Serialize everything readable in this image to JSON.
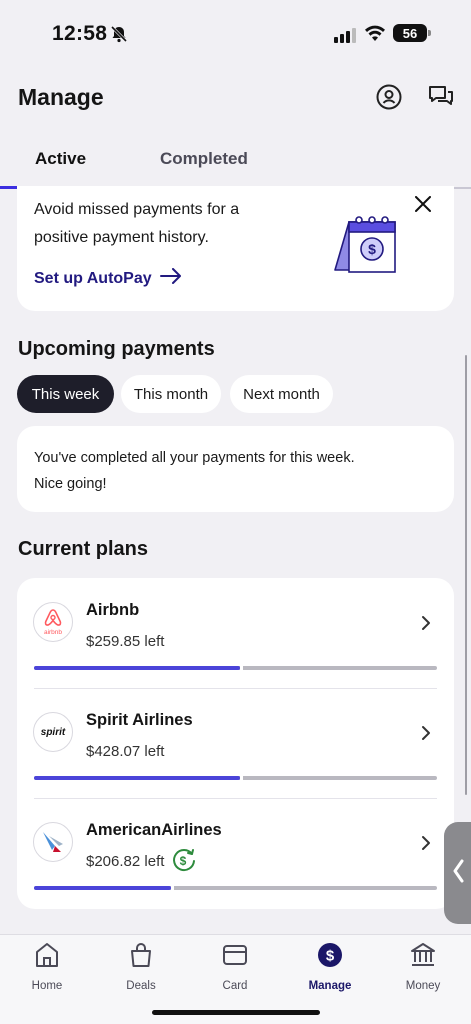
{
  "status_bar": {
    "time": "12:58",
    "battery": "56"
  },
  "header": {
    "title": "Manage"
  },
  "tabs": [
    {
      "label": "Active"
    },
    {
      "label": "Completed"
    }
  ],
  "autopay": {
    "message": "Avoid missed payments for a positive payment history.",
    "link_label": "Set up AutoPay"
  },
  "upcoming": {
    "title": "Upcoming payments",
    "filters": [
      {
        "label": "This week"
      },
      {
        "label": "This month"
      },
      {
        "label": "Next month"
      }
    ],
    "selected_filter": "This week",
    "message_line1": "You've completed all your payments for this week.",
    "message_line2": "Nice going!"
  },
  "plans": {
    "title": "Current plans",
    "items": [
      {
        "merchant": "Airbnb",
        "logo_text": "airbnb",
        "remaining": "$259.85 left",
        "progress": 0.51
      },
      {
        "merchant": "Spirit Airlines",
        "logo_text": "spirit",
        "remaining": "$428.07 left",
        "progress": 0.51
      },
      {
        "merchant": "AmericanAirlines",
        "logo_text": "",
        "remaining": "$206.82 left",
        "progress": 0.34
      }
    ]
  },
  "bottom_nav": [
    {
      "label": "Home",
      "icon": "home-icon"
    },
    {
      "label": "Deals",
      "icon": "shopping-bag-icon"
    },
    {
      "label": "Card",
      "icon": "card-icon"
    },
    {
      "label": "Manage",
      "icon": "dollar-circle-icon"
    },
    {
      "label": "Money",
      "icon": "bank-icon"
    }
  ],
  "colors": {
    "accent": "#4b44d9",
    "brand_dark": "#221a80",
    "airbnb": "#ff5a5f"
  }
}
